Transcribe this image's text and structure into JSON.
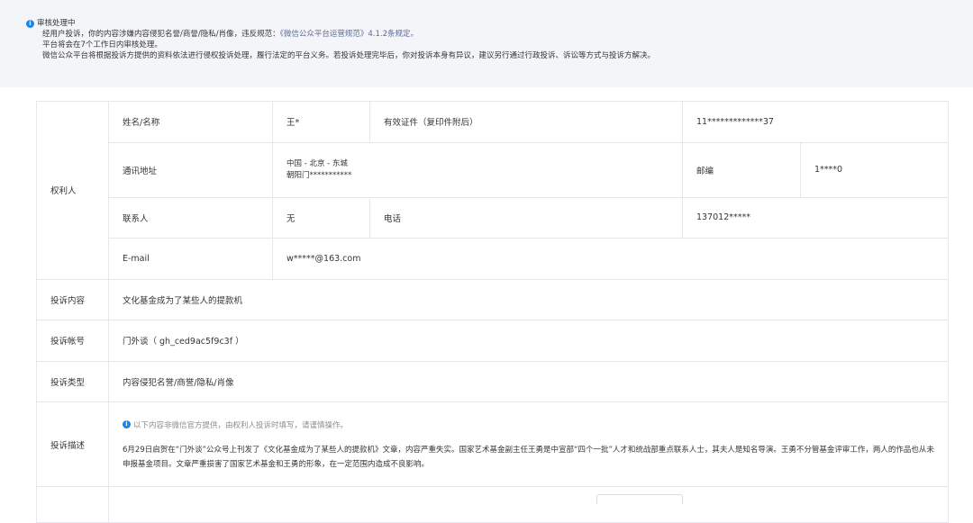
{
  "notice": {
    "status": "审核处理中",
    "line1_prefix": "经用户投诉，你的内容涉嫌内容侵犯名誉/商誉/隐私/肖像，违反规范：",
    "line1_link": "《微信公众平台运营规范》4.1.2条规定。",
    "line2": "平台将会在7个工作日内审核处理。",
    "line3": "微信公众平台将根据投诉方提供的资料依法进行侵权投诉处理，履行法定的平台义务。若投诉处理完毕后，你对投诉本身有异议，建议另行通过行政投诉、诉讼等方式与投诉方解决。"
  },
  "rights_holder": {
    "section_label": "权利人",
    "name_label": "姓名/名称",
    "name_value": "王*",
    "id_label": "有效证件（复印件附后）",
    "id_value": "11*************37",
    "address_label": "通讯地址",
    "address_line1": "中国 - 北京 - 东城",
    "address_line2": "朝阳门***********",
    "postcode_label": "邮编",
    "postcode_value": "1****0",
    "contact_label": "联系人",
    "contact_value": "无",
    "phone_label": "电话",
    "phone_value": "137012*****",
    "email_label": "E-mail",
    "email_value": "w*****@163.com"
  },
  "complaint": {
    "content_label": "投诉内容",
    "content_value": "文化基金成为了某些人的提款机",
    "account_label": "投诉帐号",
    "account_value": "门外谈（ gh_ced9ac5f9c3f ）",
    "type_label": "投诉类型",
    "type_value": "内容侵犯名誉/商誉/隐私/肖像",
    "desc_label": "投诉描述",
    "desc_tip": "以下内容非微信官方提供，由权利人投诉时填写，请谨慎操作。",
    "desc_text": "6月29日启贺在“门外谈”公众号上刊发了《文化基金成为了某些人的提款机》文章，内容严重失实。国家艺术基金副主任王勇是中宣部“四个一批”人才和统战部重点联系人士，其夫人是知名导演。王勇不分管基金评审工作，两人的作品也从未申报基金项目。文章严重损害了国家艺术基金和王勇的形象，在一定范围内造成不良影响。"
  }
}
